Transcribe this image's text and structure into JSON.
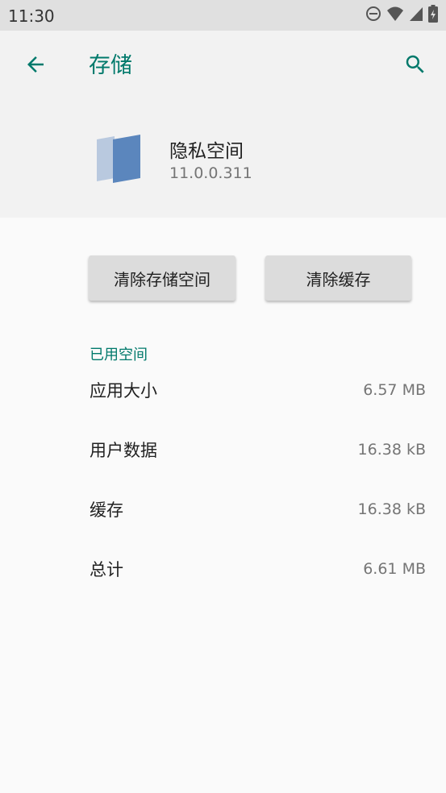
{
  "status_bar": {
    "time": "11:30",
    "icons": [
      "do-not-disturb-icon",
      "wifi-icon",
      "signal-icon",
      "battery-charging-icon"
    ]
  },
  "toolbar": {
    "title": "存储",
    "back_icon": "arrow-back-icon",
    "search_icon": "search-icon"
  },
  "app": {
    "name": "隐私空间",
    "version": "11.0.0.311",
    "icon": "privacy-space-app-icon"
  },
  "buttons": {
    "clear_storage": "清除存储空间",
    "clear_cache": "清除缓存"
  },
  "storage": {
    "section_title": "已用空间",
    "rows": [
      {
        "label": "应用大小",
        "value": "6.57 MB"
      },
      {
        "label": "用户数据",
        "value": "16.38 kB"
      },
      {
        "label": "缓存",
        "value": "16.38 kB"
      },
      {
        "label": "总计",
        "value": "6.61 MB"
      }
    ]
  },
  "colors": {
    "accent": "#00796b",
    "header_bg": "#f2f2f2",
    "status_bar_bg": "#e0e0e0",
    "button_bg": "#dcdcdc",
    "icon_blue": "#5b86bd"
  }
}
